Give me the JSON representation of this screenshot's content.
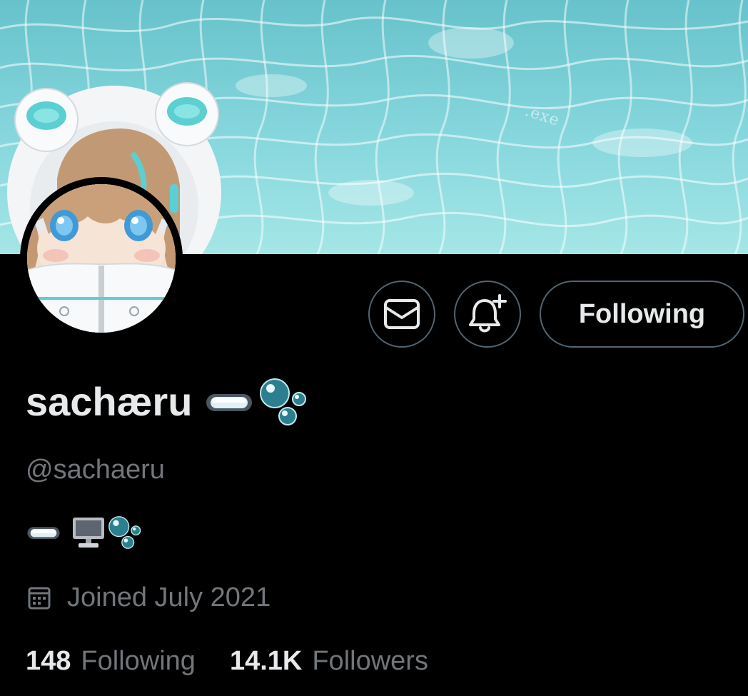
{
  "profile": {
    "display_name": "sachæru",
    "handle": "@sachaeru",
    "name_emoji": [
      "goggles-icon",
      "bubbles-icon"
    ],
    "bio_emoji": [
      "goggles-icon",
      "desktop-computer-icon",
      "bubbles-icon"
    ],
    "joined": "Joined July 2021",
    "following_count": "148",
    "following_label": "Following",
    "followers_count": "14.1K",
    "followers_label": "Followers"
  },
  "banner": {
    "watermark": ".exe"
  },
  "actions": {
    "message_icon": "envelope-icon",
    "notify_icon": "bell-plus-icon",
    "following_button": "Following"
  },
  "colors": {
    "background": "#000000",
    "primary_text": "#e7e9ea",
    "secondary_text": "#71767b",
    "button_border": "#536471",
    "banner_water": "#86d8de",
    "accent_teal": "#5ccfd2"
  }
}
